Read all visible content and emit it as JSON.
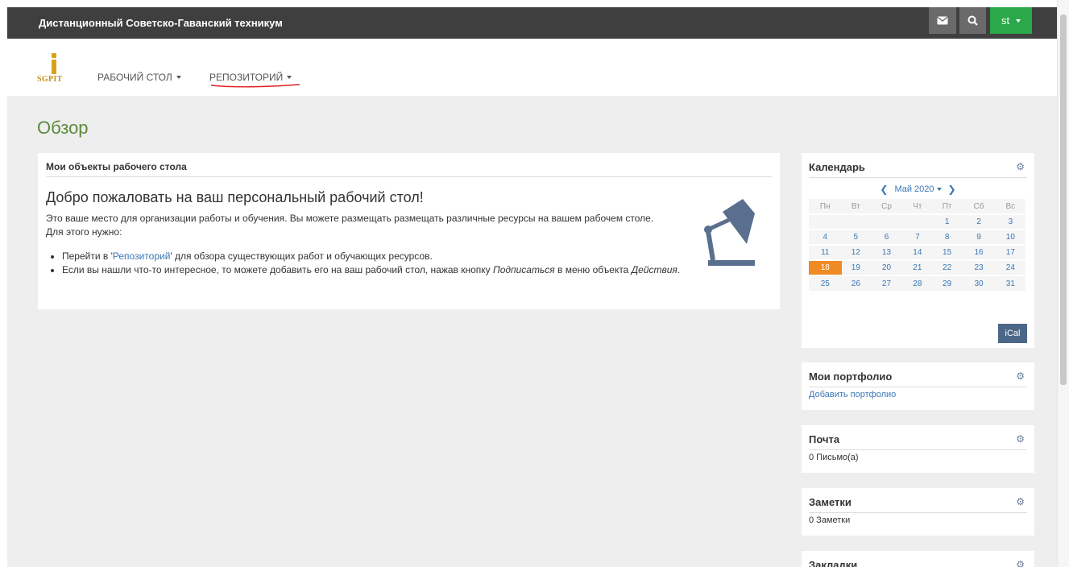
{
  "header": {
    "site_title": "Дистанционный Советско-Гаванский техникум",
    "user_label": "st"
  },
  "nav": {
    "logo_text": "SGPIT",
    "items": [
      {
        "label": "РАБОЧИЙ СТОЛ"
      },
      {
        "label": "РЕПОЗИТОРИЙ"
      }
    ]
  },
  "page": {
    "title": "Обзор"
  },
  "main_panel": {
    "heading": "Мои объекты рабочего стола",
    "welcome_title": "Добро пожаловать на ваш персональный рабочий стол!",
    "welcome_text": "Это ваше место для организации работы и обучения. Вы можете размещать размещать различные ресурсы на вашем рабочем столе. Для этого нужно:",
    "list": {
      "item1_prefix": "Перейти в '",
      "item1_link": "Репозиторий",
      "item1_suffix": "' для обзора существующих работ и обучающих ресурсов.",
      "item2_prefix": "Если вы нашли что-то интересное, то можете добавить его на ваш рабочий стол, нажав кнопку ",
      "item2_em1": "Подписаться",
      "item2_mid": " в меню объекта ",
      "item2_em2": "Действия",
      "item2_suffix": "."
    }
  },
  "calendar": {
    "heading": "Календарь",
    "month_label": "Май 2020",
    "weekdays": [
      "Пн",
      "Вт",
      "Ср",
      "Чт",
      "Пт",
      "Сб",
      "Вс"
    ],
    "weeks": [
      [
        "",
        "",
        "",
        "",
        "1",
        "2",
        "3"
      ],
      [
        "4",
        "5",
        "6",
        "7",
        "8",
        "9",
        "10"
      ],
      [
        "11",
        "12",
        "13",
        "14",
        "15",
        "16",
        "17"
      ],
      [
        "18",
        "19",
        "20",
        "21",
        "22",
        "23",
        "24"
      ],
      [
        "25",
        "26",
        "27",
        "28",
        "29",
        "30",
        "31"
      ]
    ],
    "today": "18",
    "ical_label": "iCal"
  },
  "portfolio": {
    "heading": "Мои портфолио",
    "link": "Добавить портфолио"
  },
  "mail": {
    "heading": "Почта",
    "text": "0 Письмо(а)"
  },
  "notes": {
    "heading": "Заметки",
    "text": "0 Заметки"
  },
  "bookmarks": {
    "heading": "Закладки"
  },
  "colors": {
    "topbar": "#3f3f3f",
    "user_button": "#2aa84a",
    "page_title": "#5b8a3c",
    "link": "#3a77b5",
    "today": "#f08a24",
    "ical": "#4b6788",
    "lamp": "#5a6f8e"
  },
  "icons": {
    "mail": "envelope-icon",
    "search": "search-icon",
    "gear": "gear-icon",
    "lamp": "desk-lamp-icon"
  }
}
